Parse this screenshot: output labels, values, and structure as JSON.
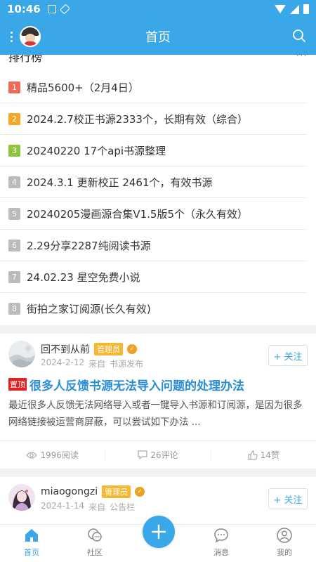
{
  "status_bar": {
    "time": "10:46"
  },
  "app_bar": {
    "title": "首页"
  },
  "rank": {
    "header": "排行榜",
    "more": "···",
    "items": [
      {
        "num": "1",
        "text": "精品5600+（2月4日）",
        "color": "#f06a5a"
      },
      {
        "num": "2",
        "text": "2024.2.7校正书源2333个，长期有效（综合）",
        "color": "#f5a623"
      },
      {
        "num": "3",
        "text": "20240220 17个api书源整理",
        "color": "#8cc63f"
      },
      {
        "num": "4",
        "text": "2024.3.1 更新校正 2461个，有效书源",
        "color": "#bbbbbb"
      },
      {
        "num": "5",
        "text": "20240205漫画源合集V1.5版5个（永久有效）",
        "color": "#bbbbbb"
      },
      {
        "num": "6",
        "text": "2.29分享2287纯阅读书源",
        "color": "#bbbbbb"
      },
      {
        "num": "7",
        "text": "24.02.23 星空免费小说",
        "color": "#bbbbbb"
      },
      {
        "num": "8",
        "text": "街拍之家订阅源(长久有效)",
        "color": "#bbbbbb"
      }
    ]
  },
  "posts": [
    {
      "author": "回不到从前",
      "badge": "管理员",
      "date": "2024-2-12",
      "source_prefix": "来自",
      "source": "书源发布",
      "follow": "+ 关注",
      "pin": "置顶",
      "title": "很多人反馈书源无法导入问题的处理办法",
      "excerpt": "最近很多人反馈无法网络导入或者一键导入书源和订阅源，是因为很多网络链接被运营商屏蔽，可以尝试如下办法 ...",
      "reads": "1996阅读",
      "comments": "26评论",
      "likes": "14赞"
    },
    {
      "author": "miaogongzi",
      "badge": "管理员",
      "date": "2024-1-14",
      "source_prefix": "来自",
      "source": "公告栏",
      "follow": "+ 关注"
    }
  ],
  "tabs": [
    {
      "label": "首页",
      "icon": "home-icon"
    },
    {
      "label": "社区",
      "icon": "community-icon"
    },
    {
      "label": "消息",
      "icon": "message-icon"
    },
    {
      "label": "我的",
      "icon": "profile-icon"
    }
  ],
  "colors": {
    "primary": "#3aa7e8",
    "badge": "#f7b733",
    "pin": "#e02020"
  }
}
